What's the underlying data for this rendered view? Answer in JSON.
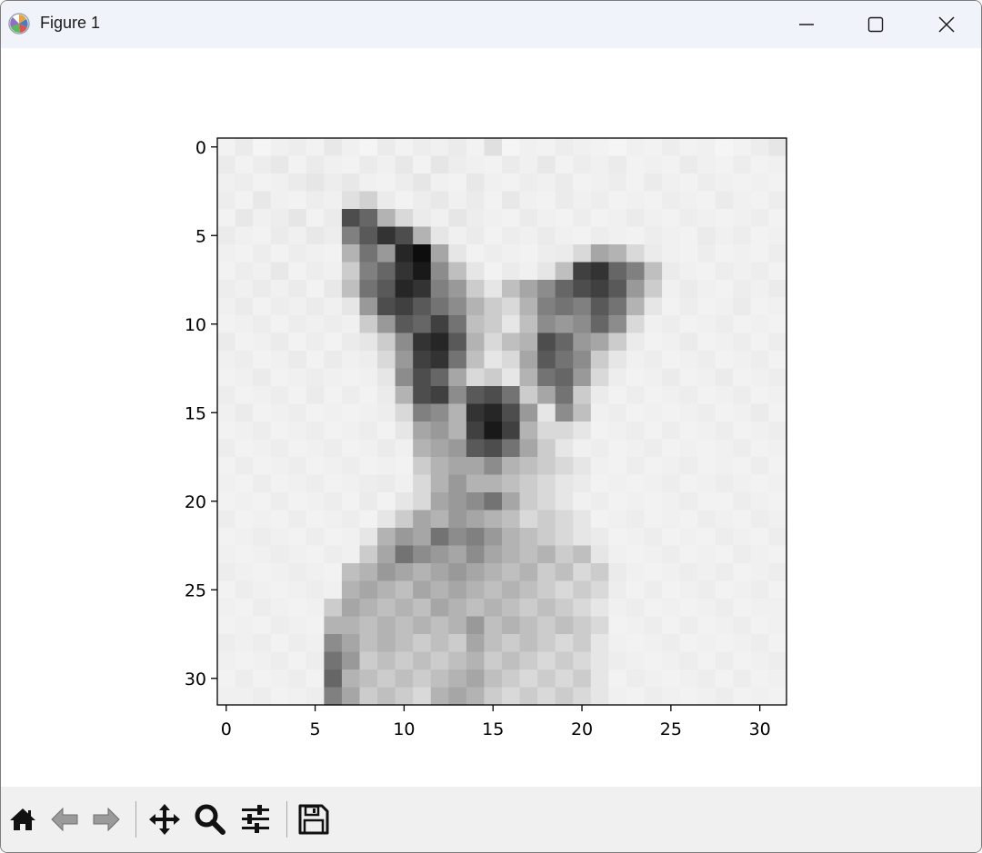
{
  "window": {
    "title": "Figure 1",
    "controls": [
      "minimize-icon",
      "maximize-icon",
      "close-icon"
    ]
  },
  "toolbar": {
    "buttons": [
      "home-icon",
      "back-arrow-icon",
      "forward-arrow-icon",
      "pan-move-icon",
      "zoom-magnifier-icon",
      "configure-subplots-icon",
      "save-floppy-icon"
    ]
  },
  "chart_data": {
    "type": "heatmap",
    "colormap": "Greys",
    "title": "",
    "xlabel": "",
    "ylabel": "",
    "rows": 32,
    "cols": 32,
    "x_ticks": [
      "0",
      "5",
      "10",
      "15",
      "20",
      "25",
      "30"
    ],
    "y_ticks": [
      "0",
      "5",
      "10",
      "15",
      "20",
      "25",
      "30"
    ],
    "y_axis_inverted": true,
    "description_note_values_are_darkness_0_to_1": "",
    "values": [
      [
        0.05,
        0.08,
        0.04,
        0.06,
        0.07,
        0.05,
        0.09,
        0.06,
        0.04,
        0.08,
        0.05,
        0.07,
        0.06,
        0.08,
        0.05,
        0.12,
        0.04,
        0.06,
        0.05,
        0.07,
        0.06,
        0.05,
        0.04,
        0.06,
        0.05,
        0.07,
        0.05,
        0.06,
        0.04,
        0.05,
        0.07,
        0.1
      ],
      [
        0.08,
        0.05,
        0.07,
        0.09,
        0.05,
        0.08,
        0.06,
        0.05,
        0.08,
        0.06,
        0.09,
        0.05,
        0.1,
        0.07,
        0.06,
        0.05,
        0.08,
        0.06,
        0.09,
        0.05,
        0.07,
        0.06,
        0.08,
        0.05,
        0.06,
        0.05,
        0.08,
        0.06,
        0.05,
        0.07,
        0.05,
        0.06
      ],
      [
        0.06,
        0.07,
        0.05,
        0.06,
        0.08,
        0.1,
        0.07,
        0.09,
        0.06,
        0.05,
        0.07,
        0.1,
        0.06,
        0.05,
        0.09,
        0.06,
        0.05,
        0.07,
        0.06,
        0.08,
        0.05,
        0.06,
        0.07,
        0.05,
        0.08,
        0.06,
        0.05,
        0.07,
        0.06,
        0.05,
        0.06,
        0.05
      ],
      [
        0.07,
        0.05,
        0.09,
        0.06,
        0.05,
        0.07,
        0.06,
        0.12,
        0.18,
        0.08,
        0.05,
        0.07,
        0.09,
        0.06,
        0.08,
        0.05,
        0.09,
        0.06,
        0.05,
        0.08,
        0.06,
        0.07,
        0.05,
        0.06,
        0.05,
        0.07,
        0.06,
        0.05,
        0.08,
        0.06,
        0.05,
        0.07
      ],
      [
        0.05,
        0.09,
        0.06,
        0.07,
        0.1,
        0.05,
        0.08,
        0.7,
        0.6,
        0.3,
        0.15,
        0.08,
        0.06,
        0.1,
        0.07,
        0.06,
        0.05,
        0.08,
        0.06,
        0.05,
        0.07,
        0.05,
        0.06,
        0.08,
        0.06,
        0.05,
        0.07,
        0.06,
        0.05,
        0.06,
        0.07,
        0.05
      ],
      [
        0.08,
        0.06,
        0.05,
        0.08,
        0.06,
        0.09,
        0.07,
        0.5,
        0.65,
        0.8,
        0.7,
        0.3,
        0.1,
        0.06,
        0.08,
        0.05,
        0.07,
        0.06,
        0.08,
        0.06,
        0.05,
        0.07,
        0.06,
        0.05,
        0.07,
        0.06,
        0.05,
        0.08,
        0.06,
        0.07,
        0.05,
        0.06
      ],
      [
        0.06,
        0.05,
        0.07,
        0.05,
        0.07,
        0.06,
        0.05,
        0.3,
        0.55,
        0.4,
        0.85,
        0.95,
        0.35,
        0.1,
        0.05,
        0.07,
        0.06,
        0.05,
        0.07,
        0.08,
        0.15,
        0.35,
        0.3,
        0.15,
        0.08,
        0.06,
        0.05,
        0.07,
        0.05,
        0.06,
        0.05,
        0.07
      ],
      [
        0.05,
        0.07,
        0.06,
        0.09,
        0.05,
        0.07,
        0.06,
        0.2,
        0.5,
        0.6,
        0.8,
        0.9,
        0.45,
        0.25,
        0.1,
        0.05,
        0.08,
        0.06,
        0.1,
        0.25,
        0.75,
        0.8,
        0.6,
        0.5,
        0.25,
        0.08,
        0.06,
        0.05,
        0.07,
        0.06,
        0.07,
        0.05
      ],
      [
        0.07,
        0.06,
        0.08,
        0.06,
        0.08,
        0.05,
        0.09,
        0.25,
        0.55,
        0.65,
        0.85,
        0.8,
        0.5,
        0.4,
        0.2,
        0.1,
        0.25,
        0.35,
        0.45,
        0.6,
        0.7,
        0.75,
        0.65,
        0.4,
        0.2,
        0.06,
        0.08,
        0.06,
        0.05,
        0.07,
        0.06,
        0.08
      ],
      [
        0.06,
        0.08,
        0.05,
        0.07,
        0.06,
        0.08,
        0.06,
        0.1,
        0.4,
        0.7,
        0.75,
        0.65,
        0.55,
        0.45,
        0.3,
        0.2,
        0.15,
        0.3,
        0.5,
        0.55,
        0.5,
        0.65,
        0.55,
        0.3,
        0.1,
        0.05,
        0.07,
        0.05,
        0.06,
        0.08,
        0.05,
        0.06
      ],
      [
        0.05,
        0.06,
        0.07,
        0.05,
        0.07,
        0.06,
        0.07,
        0.06,
        0.2,
        0.4,
        0.65,
        0.6,
        0.75,
        0.55,
        0.25,
        0.2,
        0.1,
        0.25,
        0.45,
        0.4,
        0.45,
        0.6,
        0.45,
        0.15,
        0.06,
        0.07,
        0.05,
        0.06,
        0.07,
        0.05,
        0.06,
        0.05
      ],
      [
        0.08,
        0.05,
        0.06,
        0.08,
        0.05,
        0.07,
        0.05,
        0.08,
        0.1,
        0.2,
        0.45,
        0.8,
        0.85,
        0.65,
        0.3,
        0.15,
        0.25,
        0.3,
        0.7,
        0.6,
        0.4,
        0.35,
        0.2,
        0.08,
        0.05,
        0.06,
        0.08,
        0.05,
        0.06,
        0.07,
        0.05,
        0.07
      ],
      [
        0.06,
        0.07,
        0.05,
        0.06,
        0.08,
        0.05,
        0.08,
        0.06,
        0.07,
        0.15,
        0.4,
        0.75,
        0.8,
        0.55,
        0.25,
        0.1,
        0.15,
        0.35,
        0.65,
        0.55,
        0.45,
        0.2,
        0.1,
        0.06,
        0.07,
        0.05,
        0.06,
        0.07,
        0.05,
        0.06,
        0.07,
        0.05
      ],
      [
        0.05,
        0.06,
        0.08,
        0.05,
        0.06,
        0.07,
        0.06,
        0.05,
        0.06,
        0.1,
        0.45,
        0.7,
        0.6,
        0.35,
        0.15,
        0.2,
        0.1,
        0.3,
        0.55,
        0.6,
        0.4,
        0.15,
        0.07,
        0.05,
        0.06,
        0.08,
        0.05,
        0.06,
        0.08,
        0.05,
        0.06,
        0.07
      ],
      [
        0.07,
        0.05,
        0.06,
        0.07,
        0.05,
        0.08,
        0.05,
        0.07,
        0.05,
        0.08,
        0.3,
        0.7,
        0.75,
        0.45,
        0.65,
        0.7,
        0.55,
        0.2,
        0.35,
        0.55,
        0.2,
        0.08,
        0.05,
        0.07,
        0.05,
        0.06,
        0.07,
        0.05,
        0.06,
        0.07,
        0.05,
        0.06
      ],
      [
        0.06,
        0.08,
        0.05,
        0.06,
        0.07,
        0.05,
        0.06,
        0.05,
        0.06,
        0.07,
        0.15,
        0.5,
        0.45,
        0.3,
        0.8,
        0.85,
        0.7,
        0.4,
        0.1,
        0.45,
        0.25,
        0.06,
        0.07,
        0.05,
        0.06,
        0.05,
        0.06,
        0.07,
        0.05,
        0.06,
        0.08,
        0.05
      ],
      [
        0.05,
        0.06,
        0.07,
        0.05,
        0.06,
        0.07,
        0.05,
        0.06,
        0.07,
        0.05,
        0.1,
        0.35,
        0.4,
        0.3,
        0.75,
        0.9,
        0.75,
        0.3,
        0.15,
        0.15,
        0.1,
        0.05,
        0.06,
        0.07,
        0.05,
        0.07,
        0.05,
        0.06,
        0.07,
        0.05,
        0.06,
        0.07
      ],
      [
        0.07,
        0.05,
        0.06,
        0.07,
        0.05,
        0.06,
        0.07,
        0.05,
        0.06,
        0.08,
        0.06,
        0.3,
        0.35,
        0.4,
        0.65,
        0.7,
        0.55,
        0.35,
        0.2,
        0.1,
        0.06,
        0.07,
        0.05,
        0.06,
        0.07,
        0.05,
        0.06,
        0.05,
        0.06,
        0.07,
        0.05,
        0.06
      ],
      [
        0.05,
        0.07,
        0.05,
        0.06,
        0.07,
        0.05,
        0.06,
        0.07,
        0.05,
        0.06,
        0.05,
        0.2,
        0.3,
        0.35,
        0.35,
        0.45,
        0.3,
        0.25,
        0.2,
        0.15,
        0.1,
        0.06,
        0.05,
        0.07,
        0.05,
        0.06,
        0.07,
        0.05,
        0.06,
        0.05,
        0.07,
        0.05
      ],
      [
        0.06,
        0.05,
        0.07,
        0.05,
        0.06,
        0.07,
        0.05,
        0.06,
        0.07,
        0.08,
        0.06,
        0.15,
        0.3,
        0.4,
        0.3,
        0.3,
        0.25,
        0.2,
        0.15,
        0.1,
        0.08,
        0.05,
        0.06,
        0.05,
        0.06,
        0.07,
        0.05,
        0.06,
        0.07,
        0.06,
        0.05,
        0.06
      ],
      [
        0.05,
        0.06,
        0.05,
        0.07,
        0.05,
        0.06,
        0.07,
        0.05,
        0.08,
        0.05,
        0.1,
        0.15,
        0.35,
        0.4,
        0.45,
        0.55,
        0.35,
        0.2,
        0.15,
        0.1,
        0.06,
        0.07,
        0.05,
        0.06,
        0.05,
        0.06,
        0.07,
        0.05,
        0.05,
        0.07,
        0.06,
        0.05
      ],
      [
        0.07,
        0.05,
        0.06,
        0.05,
        0.07,
        0.05,
        0.06,
        0.07,
        0.05,
        0.1,
        0.2,
        0.35,
        0.3,
        0.4,
        0.35,
        0.3,
        0.25,
        0.15,
        0.2,
        0.15,
        0.1,
        0.05,
        0.06,
        0.07,
        0.05,
        0.06,
        0.05,
        0.07,
        0.06,
        0.05,
        0.07,
        0.06
      ],
      [
        0.05,
        0.06,
        0.07,
        0.06,
        0.05,
        0.07,
        0.05,
        0.06,
        0.1,
        0.3,
        0.4,
        0.35,
        0.55,
        0.45,
        0.5,
        0.4,
        0.3,
        0.25,
        0.2,
        0.15,
        0.1,
        0.08,
        0.05,
        0.06,
        0.07,
        0.05,
        0.06,
        0.05,
        0.07,
        0.06,
        0.05,
        0.07
      ],
      [
        0.06,
        0.05,
        0.06,
        0.07,
        0.06,
        0.05,
        0.07,
        0.06,
        0.2,
        0.35,
        0.55,
        0.45,
        0.4,
        0.35,
        0.45,
        0.35,
        0.3,
        0.25,
        0.3,
        0.2,
        0.25,
        0.1,
        0.06,
        0.05,
        0.06,
        0.07,
        0.05,
        0.06,
        0.05,
        0.07,
        0.06,
        0.05
      ],
      [
        0.07,
        0.06,
        0.05,
        0.06,
        0.07,
        0.06,
        0.05,
        0.25,
        0.3,
        0.4,
        0.35,
        0.3,
        0.35,
        0.4,
        0.35,
        0.3,
        0.25,
        0.3,
        0.2,
        0.25,
        0.15,
        0.2,
        0.08,
        0.06,
        0.05,
        0.06,
        0.07,
        0.06,
        0.07,
        0.05,
        0.06,
        0.07
      ],
      [
        0.05,
        0.07,
        0.06,
        0.05,
        0.06,
        0.07,
        0.06,
        0.3,
        0.35,
        0.3,
        0.25,
        0.35,
        0.3,
        0.35,
        0.3,
        0.25,
        0.3,
        0.25,
        0.2,
        0.15,
        0.2,
        0.15,
        0.07,
        0.05,
        0.07,
        0.05,
        0.06,
        0.07,
        0.05,
        0.06,
        0.07,
        0.05
      ],
      [
        0.06,
        0.05,
        0.07,
        0.06,
        0.05,
        0.06,
        0.2,
        0.35,
        0.3,
        0.25,
        0.3,
        0.25,
        0.35,
        0.3,
        0.25,
        0.3,
        0.25,
        0.2,
        0.25,
        0.2,
        0.15,
        0.1,
        0.06,
        0.07,
        0.05,
        0.06,
        0.05,
        0.06,
        0.07,
        0.05,
        0.06,
        0.06
      ],
      [
        0.05,
        0.06,
        0.05,
        0.07,
        0.06,
        0.05,
        0.3,
        0.3,
        0.25,
        0.3,
        0.25,
        0.3,
        0.25,
        0.3,
        0.4,
        0.25,
        0.3,
        0.25,
        0.2,
        0.25,
        0.2,
        0.15,
        0.05,
        0.06,
        0.07,
        0.05,
        0.07,
        0.05,
        0.06,
        0.07,
        0.05,
        0.06
      ],
      [
        0.07,
        0.06,
        0.07,
        0.05,
        0.07,
        0.06,
        0.45,
        0.35,
        0.25,
        0.3,
        0.25,
        0.2,
        0.25,
        0.2,
        0.35,
        0.25,
        0.2,
        0.25,
        0.2,
        0.15,
        0.2,
        0.1,
        0.06,
        0.05,
        0.06,
        0.07,
        0.05,
        0.06,
        0.05,
        0.06,
        0.07,
        0.05
      ],
      [
        0.06,
        0.05,
        0.06,
        0.07,
        0.05,
        0.07,
        0.55,
        0.4,
        0.2,
        0.25,
        0.2,
        0.25,
        0.2,
        0.25,
        0.3,
        0.2,
        0.25,
        0.2,
        0.15,
        0.2,
        0.15,
        0.1,
        0.07,
        0.06,
        0.05,
        0.06,
        0.07,
        0.05,
        0.07,
        0.05,
        0.06,
        0.07
      ],
      [
        0.05,
        0.07,
        0.05,
        0.06,
        0.07,
        0.05,
        0.6,
        0.3,
        0.25,
        0.2,
        0.25,
        0.2,
        0.25,
        0.3,
        0.35,
        0.25,
        0.2,
        0.15,
        0.2,
        0.15,
        0.2,
        0.1,
        0.05,
        0.07,
        0.06,
        0.05,
        0.06,
        0.07,
        0.05,
        0.07,
        0.05,
        0.06
      ],
      [
        0.06,
        0.06,
        0.07,
        0.05,
        0.06,
        0.07,
        0.5,
        0.35,
        0.2,
        0.25,
        0.2,
        0.15,
        0.3,
        0.35,
        0.3,
        0.2,
        0.15,
        0.2,
        0.15,
        0.2,
        0.15,
        0.1,
        0.06,
        0.05,
        0.07,
        0.06,
        0.05,
        0.06,
        0.07,
        0.05,
        0.06,
        0.05
      ]
    ]
  }
}
